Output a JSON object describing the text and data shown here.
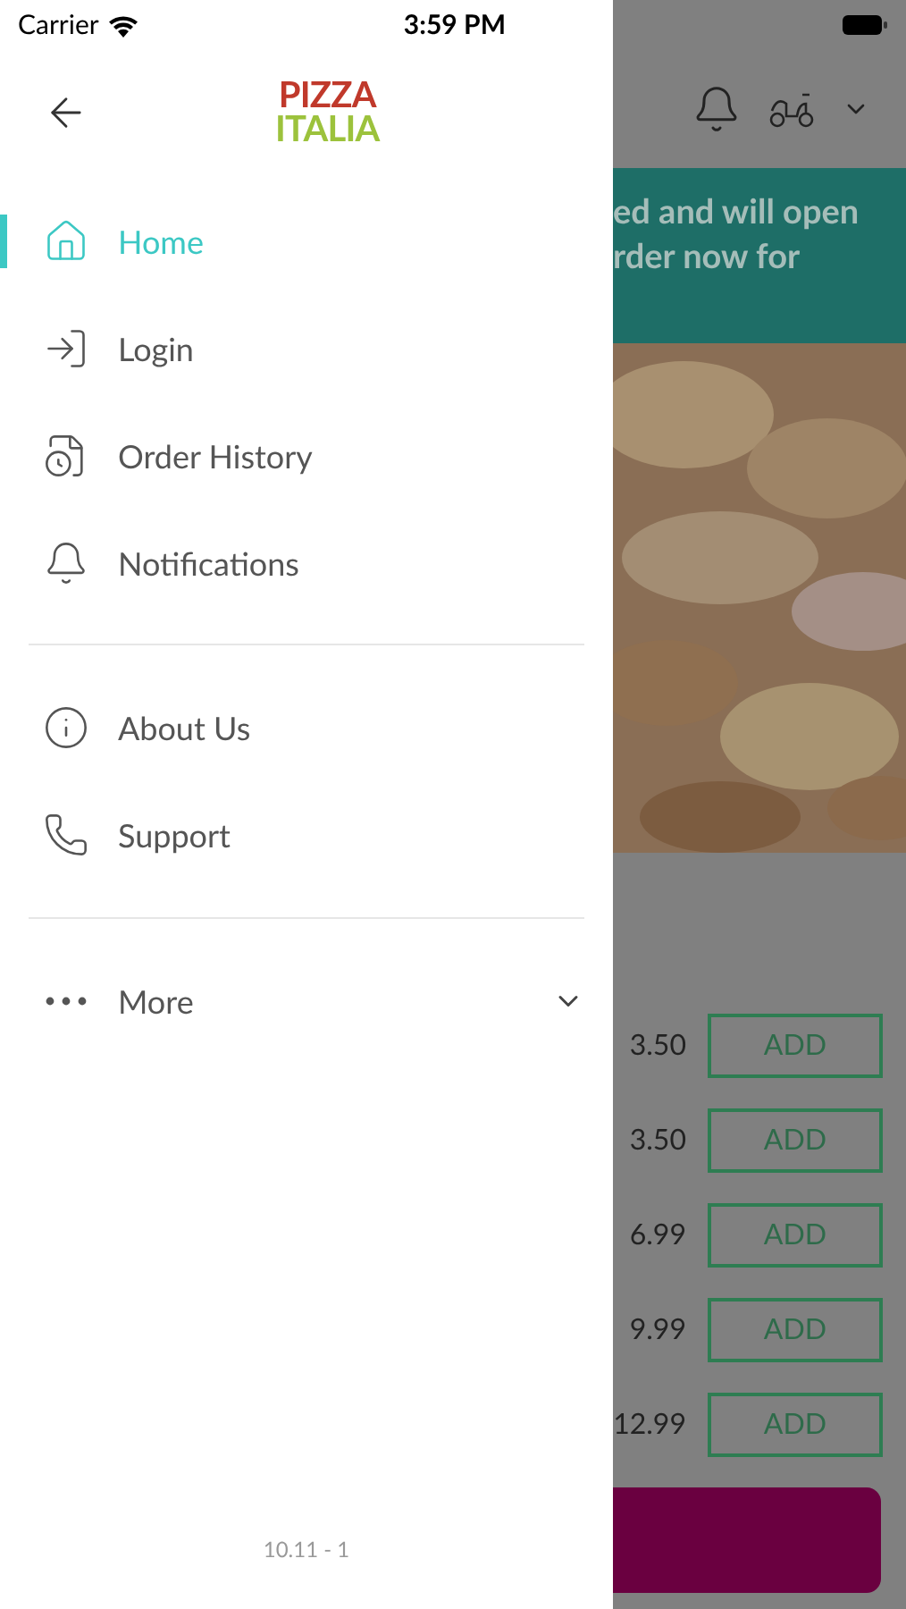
{
  "status_bar": {
    "carrier": "Carrier",
    "time": "3:59 PM"
  },
  "drawer": {
    "logo": {
      "line_1": "PIZZA",
      "line_2": "ITALIA"
    },
    "menu_groups": [
      [
        {
          "label": "Home",
          "kind": "home",
          "selected": true
        },
        {
          "label": "Login",
          "kind": "login",
          "selected": false
        },
        {
          "label": "Order History",
          "kind": "history",
          "selected": false
        },
        {
          "label": "Notifications",
          "kind": "bell",
          "selected": false
        }
      ],
      [
        {
          "label": "About Us",
          "kind": "info",
          "selected": false
        },
        {
          "label": "Support",
          "kind": "phone",
          "selected": false
        }
      ],
      [
        {
          "label": "More",
          "kind": "more",
          "selected": false,
          "expanded": false
        }
      ]
    ],
    "version": "10.11 - 1"
  },
  "background_page": {
    "banner_lines": [
      "ed and will open",
      "rder now for"
    ],
    "items": [
      {
        "price": "3.50",
        "button": "ADD"
      },
      {
        "price": "3.50",
        "button": "ADD"
      },
      {
        "price": "6.99",
        "button": "ADD"
      },
      {
        "price": "9.99",
        "button": "ADD"
      },
      {
        "price": "12.99",
        "button": "ADD"
      }
    ]
  }
}
